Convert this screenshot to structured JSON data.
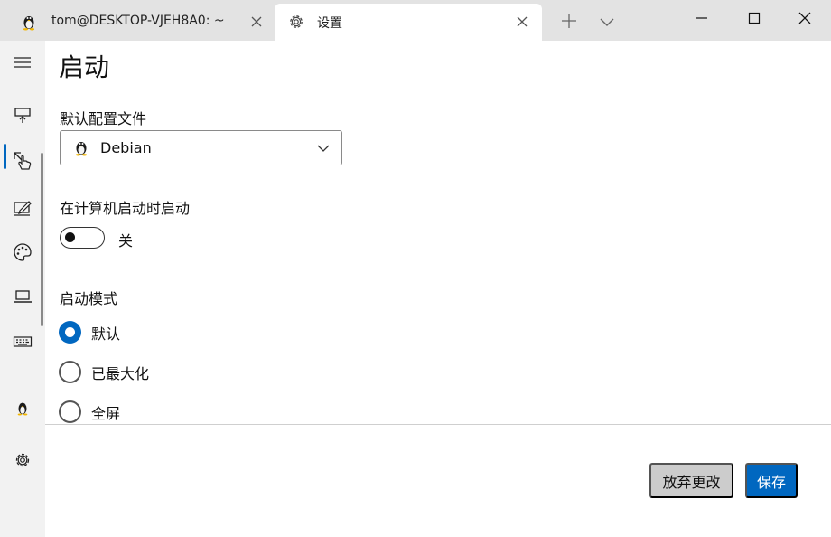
{
  "tabs": [
    {
      "title": "tom@DESKTOP-VJEH8A0: ~",
      "icon": "linux-penguin-icon",
      "active": false
    },
    {
      "title": "设置",
      "icon": "gear-icon",
      "active": true
    }
  ],
  "titlebar": {
    "new_tab_icon": "plus-icon",
    "dropdown_icon": "chevron-down-icon",
    "window_controls": [
      "minimize-icon",
      "maximize-icon",
      "close-icon"
    ]
  },
  "sidebar": {
    "items": [
      {
        "name": "menu",
        "icon": "hamburger-icon"
      },
      {
        "name": "startup",
        "icon": "startup-icon",
        "selected": true
      },
      {
        "name": "interaction",
        "icon": "pointer-hand-icon"
      },
      {
        "name": "appearance",
        "icon": "pen-screen-icon"
      },
      {
        "name": "color-schemes",
        "icon": "palette-icon"
      },
      {
        "name": "rendering",
        "icon": "laptop-icon"
      },
      {
        "name": "actions",
        "icon": "keyboard-icon"
      },
      {
        "name": "debian-profile",
        "icon": "linux-penguin-icon"
      },
      {
        "name": "open-settings",
        "icon": "gear-icon"
      }
    ]
  },
  "page": {
    "title": "启动",
    "default_profile_label": "默认配置文件",
    "default_profile_value": "Debian",
    "launch_on_startup_label": "在计算机启动时启动",
    "launch_on_startup_state": "关",
    "launch_mode_label": "启动模式",
    "launch_mode_options": [
      {
        "label": "默认",
        "checked": true
      },
      {
        "label": "已最大化",
        "checked": false
      },
      {
        "label": "全屏",
        "checked": false
      }
    ]
  },
  "footer": {
    "discard_label": "放弃更改",
    "save_label": "保存"
  },
  "colors": {
    "accent": "#0067c0",
    "titlebar": "#e3e3e3",
    "sidebar": "#f2f2f2"
  }
}
